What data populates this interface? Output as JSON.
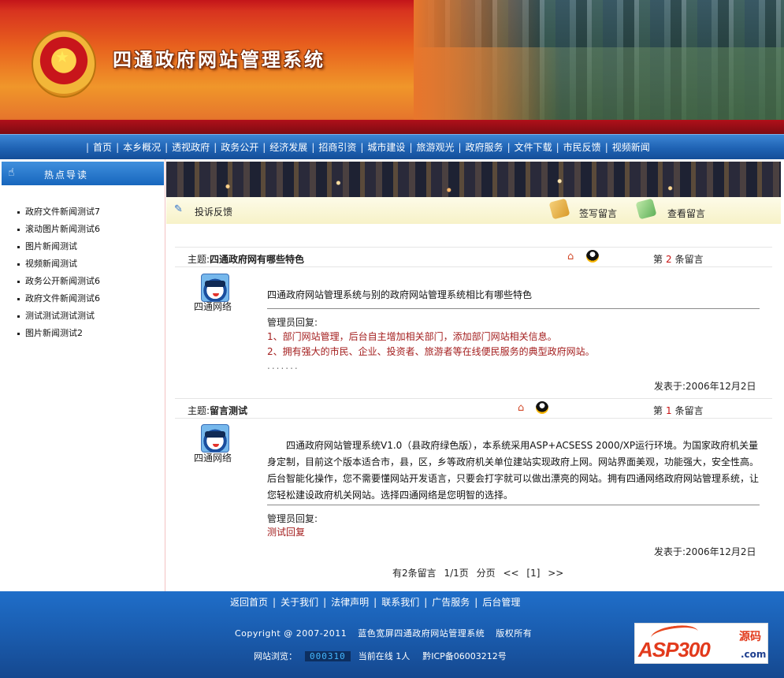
{
  "header": {
    "site_title": "四通政府网站管理系统"
  },
  "nav": {
    "items": [
      "首页",
      "本乡概况",
      "透视政府",
      "政务公开",
      "经济发展",
      "招商引资",
      "城市建设",
      "旅游观光",
      "政府服务",
      "文件下载",
      "市民反馈",
      "视频新闻"
    ]
  },
  "sidebar": {
    "title": "热点导读",
    "items": [
      "政府文件新闻测试7",
      "滚动图片新闻测试6",
      "图片新闻测试",
      "视频新闻测试",
      "政务公开新闻测试6",
      "政府文件新闻测试6",
      "测试测试测试测试",
      "图片新闻测试2"
    ]
  },
  "toolbar": {
    "section_label": "投诉反馈",
    "sign_label": "签写留言",
    "view_label": "查看留言"
  },
  "messages": [
    {
      "subject_prefix": "主题:",
      "subject": "四通政府网有哪些特色",
      "num_prefix": "第",
      "num": "2",
      "num_suffix": "条留言",
      "user": "四通网络",
      "body": "四通政府网站管理系统与别的政府网站管理系统相比有哪些特色",
      "admin_label": "管理员回复:",
      "reply_lines": [
        "1、部门网站管理，后台自主增加相关部门，添加部门网站相关信息。",
        "2、拥有强大的市民、企业、投资者、旅游者等在线便民服务的典型政府网站。"
      ],
      "reply_dots": ".......",
      "posted": "发表于:2006年12月2日"
    },
    {
      "subject_prefix": "主题:",
      "subject": "留言测试",
      "num_prefix": "第",
      "num": "1",
      "num_suffix": "条留言",
      "user": "四通网络",
      "body": "　　四通政府网站管理系统V1.0（县政府绿色版），本系统采用ASP+ACSESS 2000/XP运行环境。为国家政府机关量身定制，目前这个版本适合市，县，区，乡等政府机关单位建站实现政府上网。网站界面美观，功能强大，安全性高。后台智能化操作，您不需要懂网站开发语言，只要会打字就可以做出漂亮的网站。拥有四通网络政府网站管理系统，让您轻松建设政府机关网站。选择四通网络是您明智的选择。",
      "admin_label": "管理员回复:",
      "reply_lines": [
        "测试回复"
      ],
      "posted": "发表于:2006年12月2日"
    }
  ],
  "pager": {
    "total": "有2条留言",
    "page": "1/1页",
    "pages_label": "分页",
    "first": "<<",
    "current": "[1]",
    "last": ">>"
  },
  "footer": {
    "links": [
      "返回首页",
      "关于我们",
      "法律声明",
      "联系我们",
      "广告服务",
      "后台管理"
    ],
    "copyright_year": "Copyright @ 2007-2011",
    "copyright_name": "蓝色宽屏四通政府网站管理系统",
    "rights": "版权所有",
    "visits_label": "网站浏览：",
    "visits_counter": "000310",
    "online": "当前在线 1人",
    "icp": "黔ICP备06003212号",
    "logo_text": "ASP300",
    "logo_cn": "源码",
    "logo_domain": ".com"
  }
}
